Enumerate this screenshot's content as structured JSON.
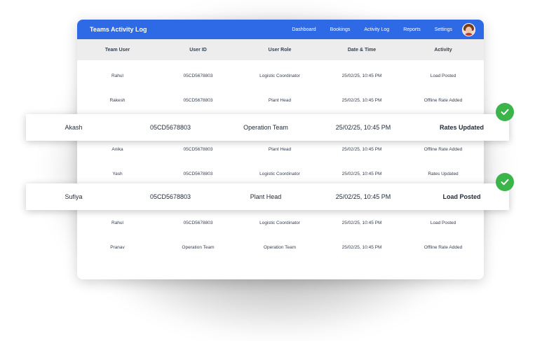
{
  "app": {
    "title": "Teams Activity Log"
  },
  "nav": [
    "Dashboard",
    "Bookings",
    "Activity Log",
    "Reports",
    "Settings"
  ],
  "columns": [
    "Team User",
    "User ID",
    "User Role",
    "Date & Time",
    "Activity"
  ],
  "rows": [
    [
      "Rahul",
      "05CD5678803",
      "Logistic Coordinator",
      "25/02/25, 10:45 PM",
      "Load Posted"
    ],
    [
      "Rakesh",
      "05CD5678803",
      "Plant Head",
      "25/02/25, 10:45 PM",
      "Offline Rate Added"
    ],
    [
      "Anika",
      "05CD5678803",
      "Plant Head",
      "25/02/25, 10:45 PM",
      "Offline Rate Added"
    ],
    [
      "Yash",
      "05CD5678803",
      "Logistic Coordinator",
      "25/02/25, 10:45 PM",
      "Rates Updated"
    ],
    [
      "Rahul",
      "05CD5678803",
      "Logistic Coordinator",
      "25/02/25, 10:45 PM",
      "Load Posted"
    ],
    [
      "Pranav",
      "Operation Team",
      "Operation Team",
      "25/02/25, 10:45 PM",
      "Offline Rate Added"
    ]
  ],
  "highlights": [
    [
      "Akash",
      "05CD5678803",
      "Operation Team",
      "25/02/25, 10:45 PM",
      "Rates Updated"
    ],
    [
      "Sufiya",
      "05CD5678803",
      "Plant Head",
      "25/02/25, 10:45 PM",
      "Load Posted"
    ]
  ],
  "colors": {
    "topbar": "#2f6ae6",
    "check": "#3bb44a"
  },
  "icons": {
    "status": "check-icon",
    "profile": "avatar"
  }
}
